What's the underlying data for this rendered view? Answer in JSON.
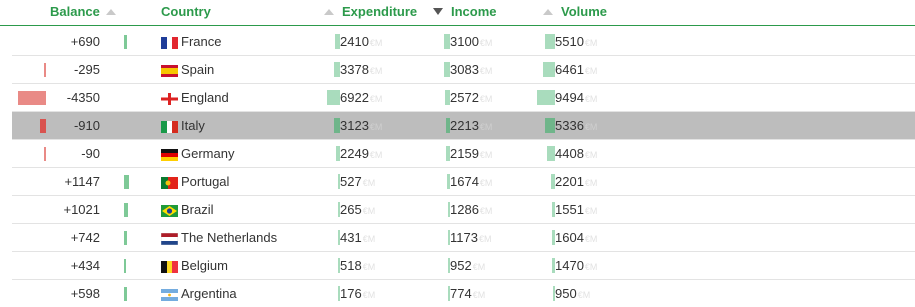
{
  "header": {
    "balance": "Balance",
    "country": "Country",
    "expenditure": "Expenditure",
    "income": "Income",
    "volume": "Volume"
  },
  "unit_suffix": "€M",
  "colors": {
    "accent": "#2c9a4b",
    "positive": "#7ec997",
    "negative": "#e98a86",
    "metric_bar": "#a9dcbd",
    "selected_row": "#bdbdbd"
  },
  "rows": [
    {
      "balance": "+690",
      "country": "France",
      "flag": "france-flag-icon",
      "expenditure": "2410",
      "income": "3100",
      "volume": "5510"
    },
    {
      "balance": "-295",
      "country": "Spain",
      "flag": "spain-flag-icon",
      "expenditure": "3378",
      "income": "3083",
      "volume": "6461"
    },
    {
      "balance": "-4350",
      "country": "England",
      "flag": "england-flag-icon",
      "expenditure": "6922",
      "income": "2572",
      "volume": "9494"
    },
    {
      "balance": "-910",
      "country": "Italy",
      "flag": "italy-flag-icon",
      "expenditure": "3123",
      "income": "2213",
      "volume": "5336",
      "selected": true
    },
    {
      "balance": "-90",
      "country": "Germany",
      "flag": "germany-flag-icon",
      "expenditure": "2249",
      "income": "2159",
      "volume": "4408"
    },
    {
      "balance": "+1147",
      "country": "Portugal",
      "flag": "portugal-flag-icon",
      "expenditure": "527",
      "income": "1674",
      "volume": "2201"
    },
    {
      "balance": "+1021",
      "country": "Brazil",
      "flag": "brazil-flag-icon",
      "expenditure": "265",
      "income": "1286",
      "volume": "1551"
    },
    {
      "balance": "+742",
      "country": "The Netherlands",
      "flag": "netherlands-flag-icon",
      "expenditure": "431",
      "income": "1173",
      "volume": "1604"
    },
    {
      "balance": "+434",
      "country": "Belgium",
      "flag": "belgium-flag-icon",
      "expenditure": "518",
      "income": "952",
      "volume": "1470"
    },
    {
      "balance": "+598",
      "country": "Argentina",
      "flag": "argentina-flag-icon",
      "expenditure": "176",
      "income": "774",
      "volume": "950"
    }
  ]
}
